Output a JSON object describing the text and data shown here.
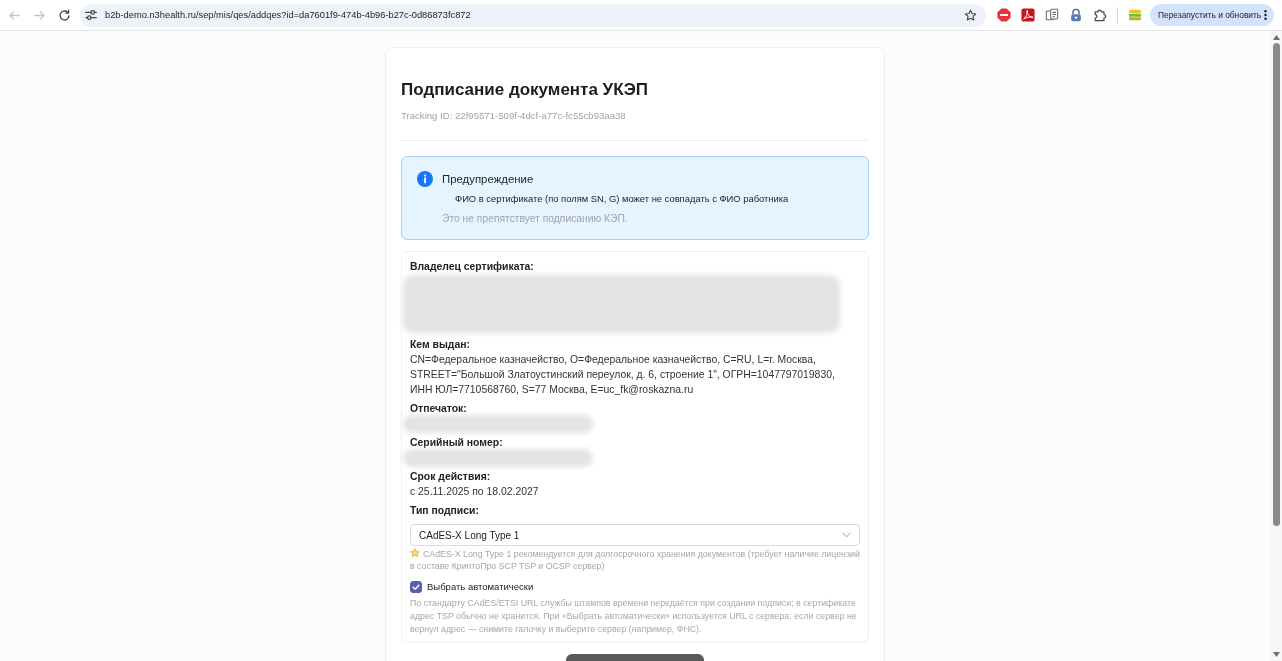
{
  "browser": {
    "nav_buttons": [
      {
        "kind": "back",
        "disabled": true
      },
      {
        "kind": "forward",
        "disabled": true
      },
      {
        "kind": "reload",
        "disabled": false
      }
    ],
    "url": "b2b-demo.n3health.ru/sep/mis/qes/addqes?id=da7601f9-474b-4b96-b27c-0d86873fc872",
    "update_button": "Перезапустить и обновить"
  },
  "page": {
    "title": "Подписание документа УКЭП",
    "tracking_id": "Tracking ID: 22f95571-509f-4dcf-a77c-fc55cb93aa38",
    "warning": {
      "title": "Предупреждение",
      "message": "ФИО в сертификате (по полям SN, G) может не совпадать с ФИО работника",
      "note": "Это не препятствует подписанию КЭП."
    },
    "certificate": {
      "fields": [
        {
          "kind": "block",
          "label": "Владелец сертификата:"
        },
        {
          "kind": "text",
          "label": "Кем выдан:",
          "value": "CN=Федеральное казначейство, O=Федеральное казначейство, C=RU, L=г. Москва, STREET=\"Большой Златоустинский переулок, д. 6, строение 1\", ОГРН=1047797019830, ИНН ЮЛ=7710568760, S=77 Москва, E=uc_fk@roskazna.ru"
        },
        {
          "kind": "line",
          "label": "Отпечаток:"
        },
        {
          "kind": "line",
          "label": "Серийный номер:"
        },
        {
          "kind": "text",
          "label": "Срок действия:",
          "value": "с 25.11.2025 по 18.02.2027"
        }
      ],
      "signature_type": {
        "label": "Тип подписи:",
        "value": "CAdES-X Long Type 1",
        "hint": "CAdES-X Long Type 1 рекомендуется для долгосрочного хранения документов (требует наличие лицензий в составе КриптоПро SCP TSP и OCSP сервер)"
      },
      "auto_select": {
        "label": "Выбрать автоматически",
        "checked": true
      },
      "auto_note": "По стандарту CAdES/ETSI URL службы штампов времени передаётся при создании подписи; в сертификате адрес TSP обычно не хранится. При «Выбрать автоматически» используется URL с сервера; если сервер не вернул адрес — снимите галочку и выберите сервер (например, ФНС)."
    }
  }
}
